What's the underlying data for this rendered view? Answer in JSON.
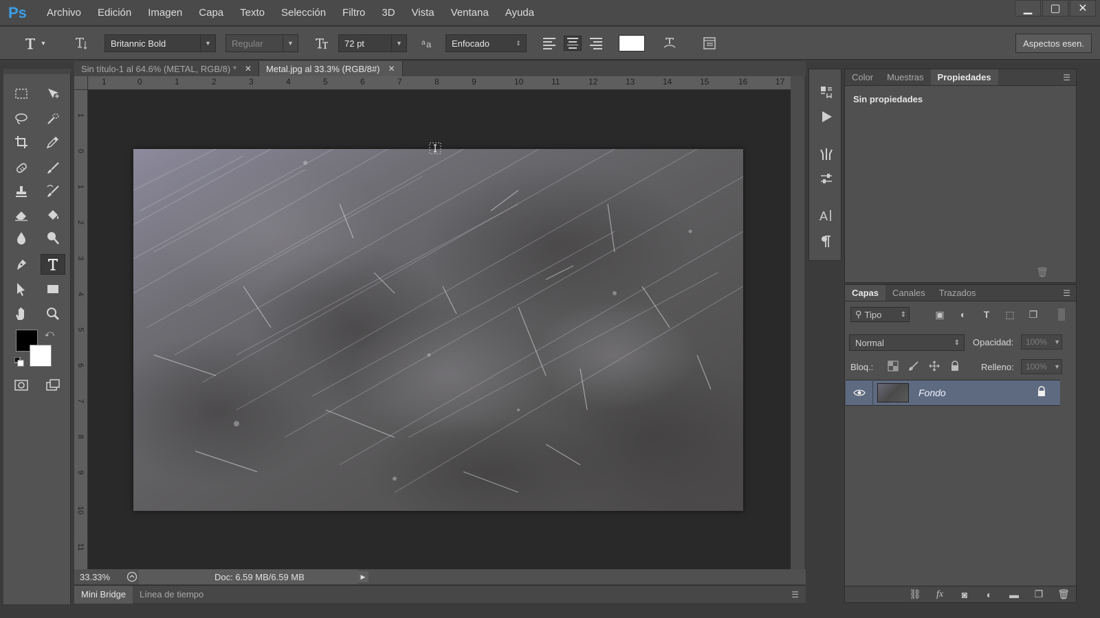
{
  "app": {
    "logo": "Ps"
  },
  "menu": [
    "Archivo",
    "Edición",
    "Imagen",
    "Capa",
    "Texto",
    "Selección",
    "Filtro",
    "3D",
    "Vista",
    "Ventana",
    "Ayuda"
  ],
  "window_controls": {
    "minimize": "▁",
    "restore": "▢",
    "close": "✕"
  },
  "options": {
    "font_family": "Britannic Bold",
    "font_style": "Regular",
    "font_size": "72 pt",
    "anti_alias": "Enfocado",
    "text_color": "#ffffff",
    "aspectos_label": "Aspectos esen."
  },
  "tabs": [
    {
      "label": "Sin título-1 al 64.6% (METAL, RGB/8) *",
      "close": "✕"
    },
    {
      "label": "Metal.jpg al 33.3% (RGB/8#)",
      "close": "✕"
    }
  ],
  "ruler": {
    "top_ticks": [
      "1",
      "0",
      "1",
      "2",
      "3",
      "4",
      "5",
      "6",
      "7",
      "8",
      "9",
      "10",
      "11",
      "12",
      "13",
      "14",
      "15",
      "16",
      "17"
    ],
    "left_ticks": [
      "1",
      "0",
      "1",
      "2",
      "3",
      "4",
      "5",
      "6",
      "7",
      "8",
      "9",
      "10",
      "11"
    ]
  },
  "status": {
    "zoom": "33.33%",
    "doc": "Doc: 6.59 MB/6.59 MB",
    "arrow": "▶"
  },
  "bottom_tabs": [
    "Mini Bridge",
    "Línea de tiempo"
  ],
  "properties_panel": {
    "tabs": [
      "Color",
      "Muestras",
      "Propiedades"
    ],
    "active_tab": "Propiedades",
    "content": "Sin propiedades"
  },
  "layers_panel": {
    "tabs": [
      "Capas",
      "Canales",
      "Trazados"
    ],
    "filter_label": "Tipo",
    "blend_mode": "Normal",
    "opacity_label": "Opacidad:",
    "opacity_value": "100%",
    "lock_label": "Bloq.:",
    "fill_label": "Relleno:",
    "fill_value": "100%",
    "layers": [
      {
        "name": "Fondo",
        "visible": true,
        "locked": true
      }
    ]
  },
  "colors": {
    "foreground": "#000000",
    "background": "#ffffff",
    "accent": "#3a9ee8",
    "layer_selected": "#5e6a80"
  }
}
